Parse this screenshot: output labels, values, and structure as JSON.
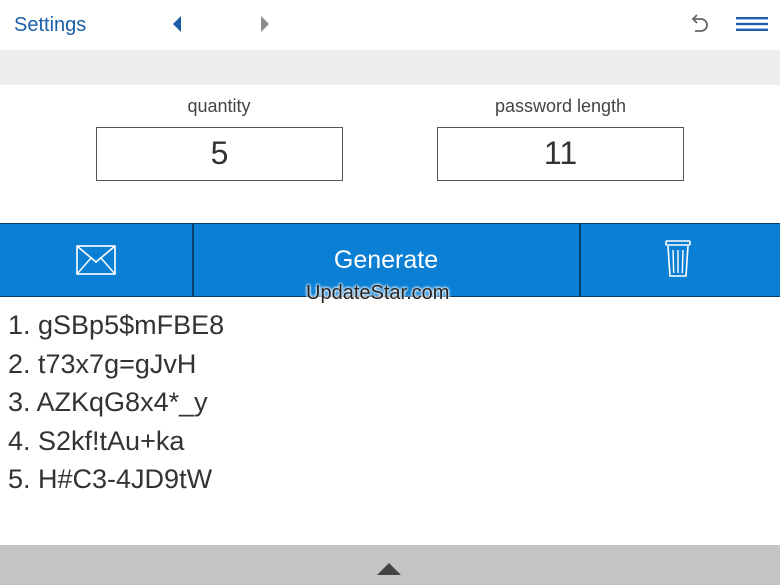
{
  "header": {
    "settings_label": "Settings",
    "icons": {
      "prev": "triangle-left-icon",
      "next": "triangle-right-icon",
      "undo": "undo-icon",
      "menu": "hamburger-menu-icon"
    }
  },
  "fields": {
    "quantity": {
      "label": "quantity",
      "value": "5"
    },
    "password_length": {
      "label": "password length",
      "value": "11"
    }
  },
  "actions": {
    "mail_icon": "envelope-icon",
    "generate_label": "Generate",
    "trash_icon": "trash-icon"
  },
  "watermark": "UpdateStar.com",
  "passwords": [
    "1. gSBp5$mFBE8",
    "2. t73x7g=gJvH",
    "3. AZKqG8x4*_y",
    "4. S2kf!tAu+ka",
    "5. H#C3-4JD9tW"
  ],
  "footer": {
    "expand_icon": "triangle-up-icon"
  },
  "colors": {
    "accent_blue": "#0a7fd4",
    "link_blue": "#1a5fa8",
    "band_gray": "#ededed",
    "footer_gray": "#c4c4c4"
  }
}
